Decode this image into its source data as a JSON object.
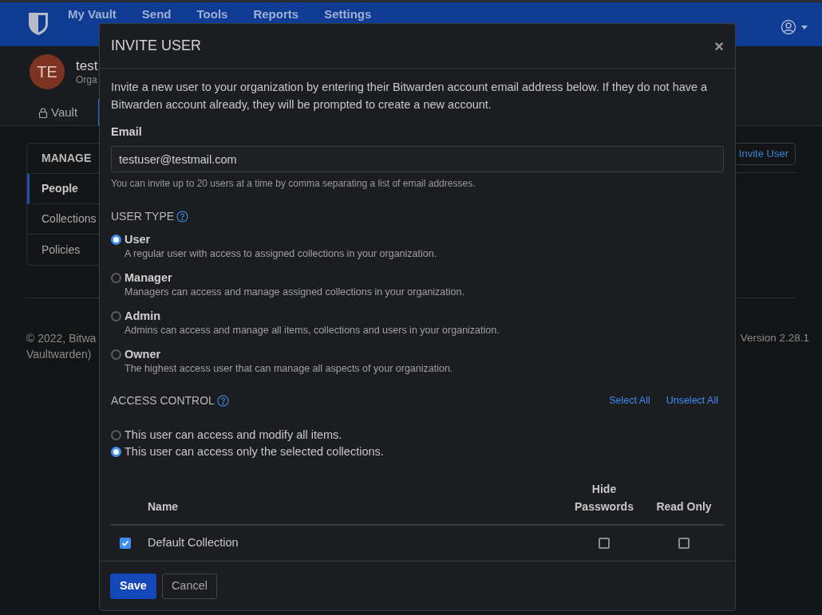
{
  "nav": {
    "items": [
      {
        "label": "My Vault"
      },
      {
        "label": "Send"
      },
      {
        "label": "Tools"
      },
      {
        "label": "Reports"
      },
      {
        "label": "Settings"
      }
    ]
  },
  "org": {
    "initials": "TE",
    "name": "test",
    "subtitle": "Orga"
  },
  "tabs": [
    {
      "label": "Vault",
      "selected": false
    }
  ],
  "sidebar": {
    "heading": "MANAGE",
    "items": [
      {
        "label": "People",
        "selected": true
      },
      {
        "label": "Collections",
        "selected": false
      },
      {
        "label": "Policies",
        "selected": false
      }
    ]
  },
  "invite_button": "Invite User",
  "footer": {
    "copyright": [
      "© 2022, Bitwa",
      "Vaultwarden)"
    ],
    "version": "Version 2.28.1"
  },
  "modal": {
    "title": "INVITE USER",
    "close": "×",
    "intro": "Invite a new user to your organization by entering their Bitwarden account email address below. If they do not have a Bitwarden account already, they will be prompted to create a new account.",
    "email": {
      "label": "Email",
      "value": "testuser@testmail.com",
      "hint": "You can invite up to 20 users at a time by comma separating a list of email addresses."
    },
    "user_type": {
      "heading": "USER TYPE",
      "options": [
        {
          "label": "User",
          "description": "A regular user with access to assigned collections in your organization.",
          "selected": true
        },
        {
          "label": "Manager",
          "description": "Managers can access and manage assigned collections in your organization.",
          "selected": false
        },
        {
          "label": "Admin",
          "description": "Admins can access and manage all items, collections and users in your organization.",
          "selected": false
        },
        {
          "label": "Owner",
          "description": "The highest access user that can manage all aspects of your organization.",
          "selected": false
        }
      ]
    },
    "access_control": {
      "heading": "ACCESS CONTROL",
      "select_all": "Select All",
      "unselect_all": "Unselect All",
      "options": [
        {
          "label": "This user can access and modify all items.",
          "selected": false
        },
        {
          "label": "This user can access only the selected collections.",
          "selected": true
        }
      ]
    },
    "table": {
      "columns": [
        "Name",
        "Hide Passwords",
        "Read Only"
      ],
      "rows": [
        {
          "name": "Default Collection",
          "checked": true,
          "hide_passwords": false,
          "read_only": false
        }
      ]
    },
    "buttons": {
      "save": "Save",
      "cancel": "Cancel"
    }
  }
}
